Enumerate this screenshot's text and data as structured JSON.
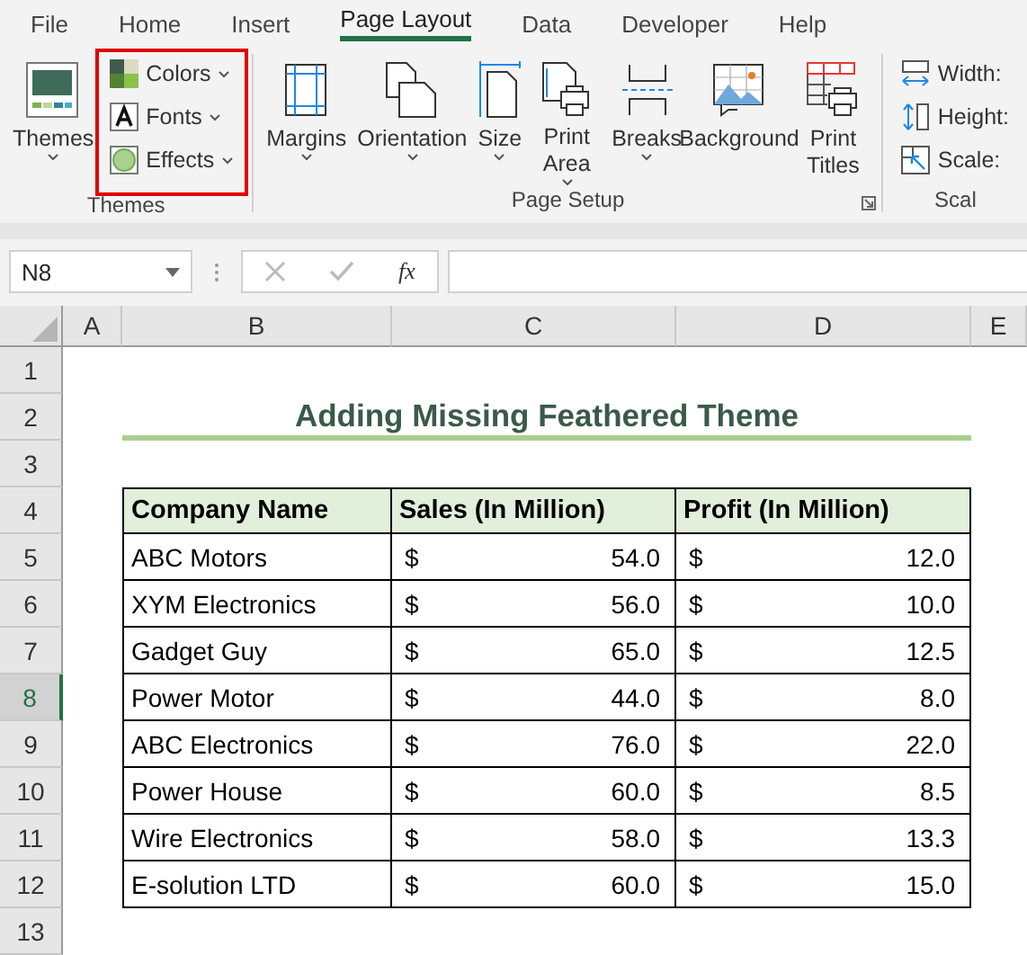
{
  "tabs": [
    {
      "label": "File",
      "selected": false
    },
    {
      "label": "Home",
      "selected": false
    },
    {
      "label": "Insert",
      "selected": false
    },
    {
      "label": "Page Layout",
      "selected": true
    },
    {
      "label": "Data",
      "selected": false
    },
    {
      "label": "Developer",
      "selected": false
    },
    {
      "label": "Help",
      "selected": false
    }
  ],
  "ribbon": {
    "groups": [
      {
        "label": "Themes",
        "launcher": false,
        "highlighted": true,
        "items": [
          {
            "kind": "large",
            "label": "Themes",
            "dropdown": true
          },
          {
            "kind": "small",
            "label": "Colors",
            "dropdown": true
          },
          {
            "kind": "small",
            "label": "Fonts",
            "dropdown": true
          },
          {
            "kind": "small",
            "label": "Effects",
            "dropdown": true
          }
        ]
      },
      {
        "label": "Page Setup",
        "launcher": true,
        "highlighted": false,
        "items": [
          {
            "kind": "large",
            "label": "Margins",
            "dropdown": true
          },
          {
            "kind": "large",
            "label": "Orientation",
            "dropdown": true
          },
          {
            "kind": "large",
            "label": "Size",
            "dropdown": true
          },
          {
            "kind": "large",
            "label": "Print Area",
            "dropdown": true
          },
          {
            "kind": "large",
            "label": "Breaks",
            "dropdown": true
          },
          {
            "kind": "large",
            "label": "Background",
            "dropdown": false
          },
          {
            "kind": "large",
            "label": "Print Titles",
            "dropdown": false
          }
        ]
      },
      {
        "label": "Scal",
        "launcher": false,
        "highlighted": false,
        "items": [
          {
            "kind": "small",
            "label": "Width:",
            "dropdown": false
          },
          {
            "kind": "small",
            "label": "Height:",
            "dropdown": false
          },
          {
            "kind": "small",
            "label": "Scale:",
            "dropdown": false
          }
        ]
      }
    ]
  },
  "formula_bar": {
    "name_box": "N8",
    "function_label": "fx"
  },
  "sheet": {
    "columns": [
      {
        "label": "A",
        "selected": false
      },
      {
        "label": "B",
        "selected": false
      },
      {
        "label": "C",
        "selected": false
      },
      {
        "label": "D",
        "selected": false
      },
      {
        "label": "E",
        "selected": false
      }
    ],
    "rows": [
      {
        "label": "1",
        "selected": false
      },
      {
        "label": "2",
        "selected": false
      },
      {
        "label": "3",
        "selected": false
      },
      {
        "label": "4",
        "selected": false
      },
      {
        "label": "5",
        "selected": false
      },
      {
        "label": "6",
        "selected": false
      },
      {
        "label": "7",
        "selected": false
      },
      {
        "label": "8",
        "selected": true
      },
      {
        "label": "9",
        "selected": false
      },
      {
        "label": "10",
        "selected": false
      },
      {
        "label": "11",
        "selected": false
      },
      {
        "label": "12",
        "selected": false
      },
      {
        "label": "13",
        "selected": false
      }
    ],
    "title": "Adding Missing Feathered Theme",
    "table": {
      "columns": [
        "Company Name",
        "Sales (In Million)",
        "Profit (In Million)"
      ],
      "rows": [
        {
          "company": "ABC Motors",
          "sales": {
            "currency": "$",
            "amount": "54.0"
          },
          "profit": {
            "currency": "$",
            "amount": "12.0"
          }
        },
        {
          "company": "XYM Electronics",
          "sales": {
            "currency": "$",
            "amount": "56.0"
          },
          "profit": {
            "currency": "$",
            "amount": "10.0"
          }
        },
        {
          "company": "Gadget Guy",
          "sales": {
            "currency": "$",
            "amount": "65.0"
          },
          "profit": {
            "currency": "$",
            "amount": "12.5"
          }
        },
        {
          "company": "Power Motor",
          "sales": {
            "currency": "$",
            "amount": "44.0"
          },
          "profit": {
            "currency": "$",
            "amount": "8.0"
          }
        },
        {
          "company": "ABC Electronics",
          "sales": {
            "currency": "$",
            "amount": "76.0"
          },
          "profit": {
            "currency": "$",
            "amount": "22.0"
          }
        },
        {
          "company": "Power House",
          "sales": {
            "currency": "$",
            "amount": "60.0"
          },
          "profit": {
            "currency": "$",
            "amount": "8.5"
          }
        },
        {
          "company": "Wire Electronics",
          "sales": {
            "currency": "$",
            "amount": "58.0"
          },
          "profit": {
            "currency": "$",
            "amount": "13.3"
          }
        },
        {
          "company": "E-solution LTD",
          "sales": {
            "currency": "$",
            "amount": "60.0"
          },
          "profit": {
            "currency": "$",
            "amount": "15.0"
          }
        }
      ]
    }
  }
}
